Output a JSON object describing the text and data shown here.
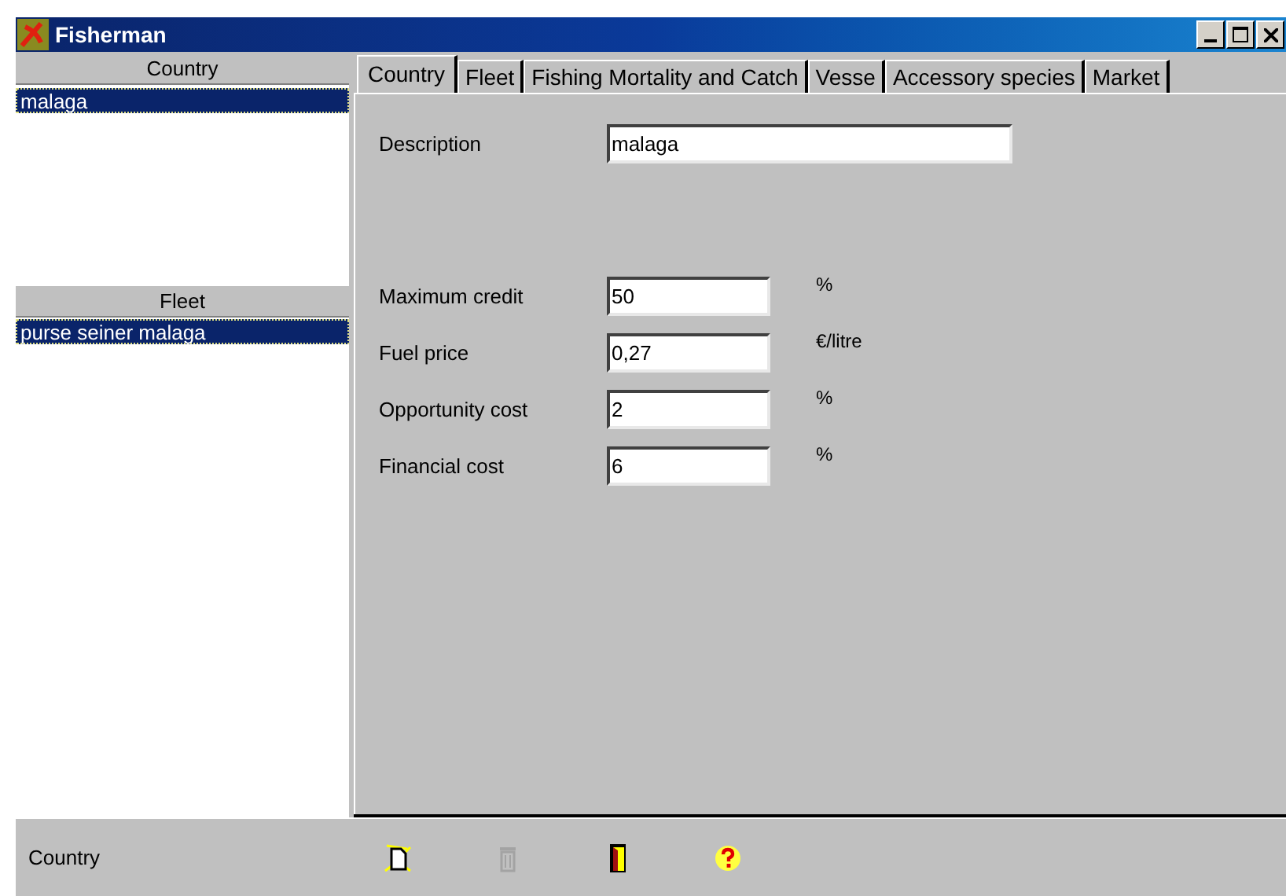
{
  "window": {
    "title": "Fisherman"
  },
  "country_list": {
    "header": "Country",
    "items": [
      {
        "label": "malaga",
        "selected": true
      }
    ]
  },
  "fleet_list": {
    "header": "Fleet",
    "items": [
      {
        "label": "purse seiner malaga",
        "selected": true
      }
    ]
  },
  "tabs": [
    {
      "label": "Country",
      "selected": true
    },
    {
      "label": "Fleet",
      "selected": false
    },
    {
      "label": "Fishing Mortality and Catch",
      "selected": false
    },
    {
      "label": "Vesse",
      "selected": false
    },
    {
      "label": "Accessory species",
      "selected": false
    },
    {
      "label": "Market",
      "selected": false
    }
  ],
  "description": {
    "label": "Description",
    "value": "malaga"
  },
  "fields": [
    {
      "label": "Maximum credit",
      "value": "50",
      "unit": "%"
    },
    {
      "label": "Fuel price",
      "value": "0,27",
      "unit": "€/litre"
    },
    {
      "label": "Opportunity cost",
      "value": "2",
      "unit": "%"
    },
    {
      "label": "Financial cost",
      "value": "6",
      "unit": "%"
    }
  ],
  "status_bar": {
    "label": "Country"
  },
  "toolbar": [
    {
      "kind": "new",
      "disabled": false
    },
    {
      "kind": "delete",
      "disabled": true
    },
    {
      "kind": "exit",
      "disabled": false
    },
    {
      "kind": "help",
      "disabled": false
    }
  ]
}
